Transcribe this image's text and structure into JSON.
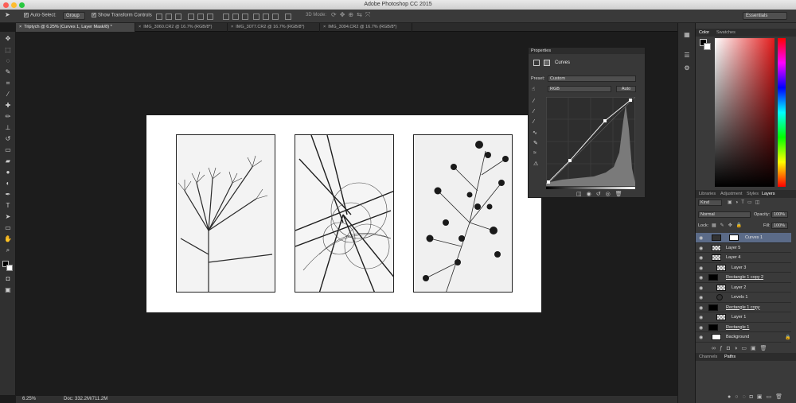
{
  "window": {
    "title": "Adobe Photoshop CC 2015"
  },
  "options_bar": {
    "auto_select_label": "Auto-Select:",
    "auto_select_value": "Group",
    "show_transform_label": "Show Transform Controls",
    "mode_3d_label": "3D Mode:",
    "workspace": "Essentials"
  },
  "tabs": [
    "Triptych @ 6.25% (Curves 1, Layer Mask/8) *",
    "IMG_3060.CR2 @ 16.7% (RGB/8*)",
    "IMG_3077.CR2 @ 16.7% (RGB/8*)",
    "IMG_3094.CR2 @ 16.7% (RGB/8*)"
  ],
  "properties": {
    "tab": "Properties",
    "adjustment": "Curves",
    "preset_label": "Preset:",
    "preset_value": "Custom",
    "channel": "RGB",
    "auto_button": "Auto"
  },
  "status": {
    "zoom": "6.25%",
    "doc": "Doc: 332.2M/711.2M"
  },
  "color_panel": {
    "tabs": [
      "Color",
      "Swatches"
    ]
  },
  "layers_panel": {
    "tabs": [
      "Libraries",
      "Adjustment",
      "Styles",
      "Layers"
    ],
    "filter": "Kind",
    "blend_mode": "Normal",
    "opacity_label": "Opacity:",
    "opacity_value": "100%",
    "lock_label": "Lock:",
    "fill_label": "Fill:",
    "fill_value": "100%",
    "layers": [
      "Curves 1",
      "Layer 5",
      "Layer 4",
      "Layer 3",
      "Rectangle 1 copy 2",
      "Layer 2",
      "Levels 1",
      "Rectangle 1 copy",
      "Layer 1",
      "Rectangle 1",
      "Background"
    ]
  },
  "bottom_panel": {
    "tabs": [
      "Channels",
      "Paths"
    ]
  },
  "colors": {
    "accent_selected": "#5b6b88",
    "canvas_bg": "#1c1c1c",
    "panel_bg": "#3a3a3a"
  }
}
